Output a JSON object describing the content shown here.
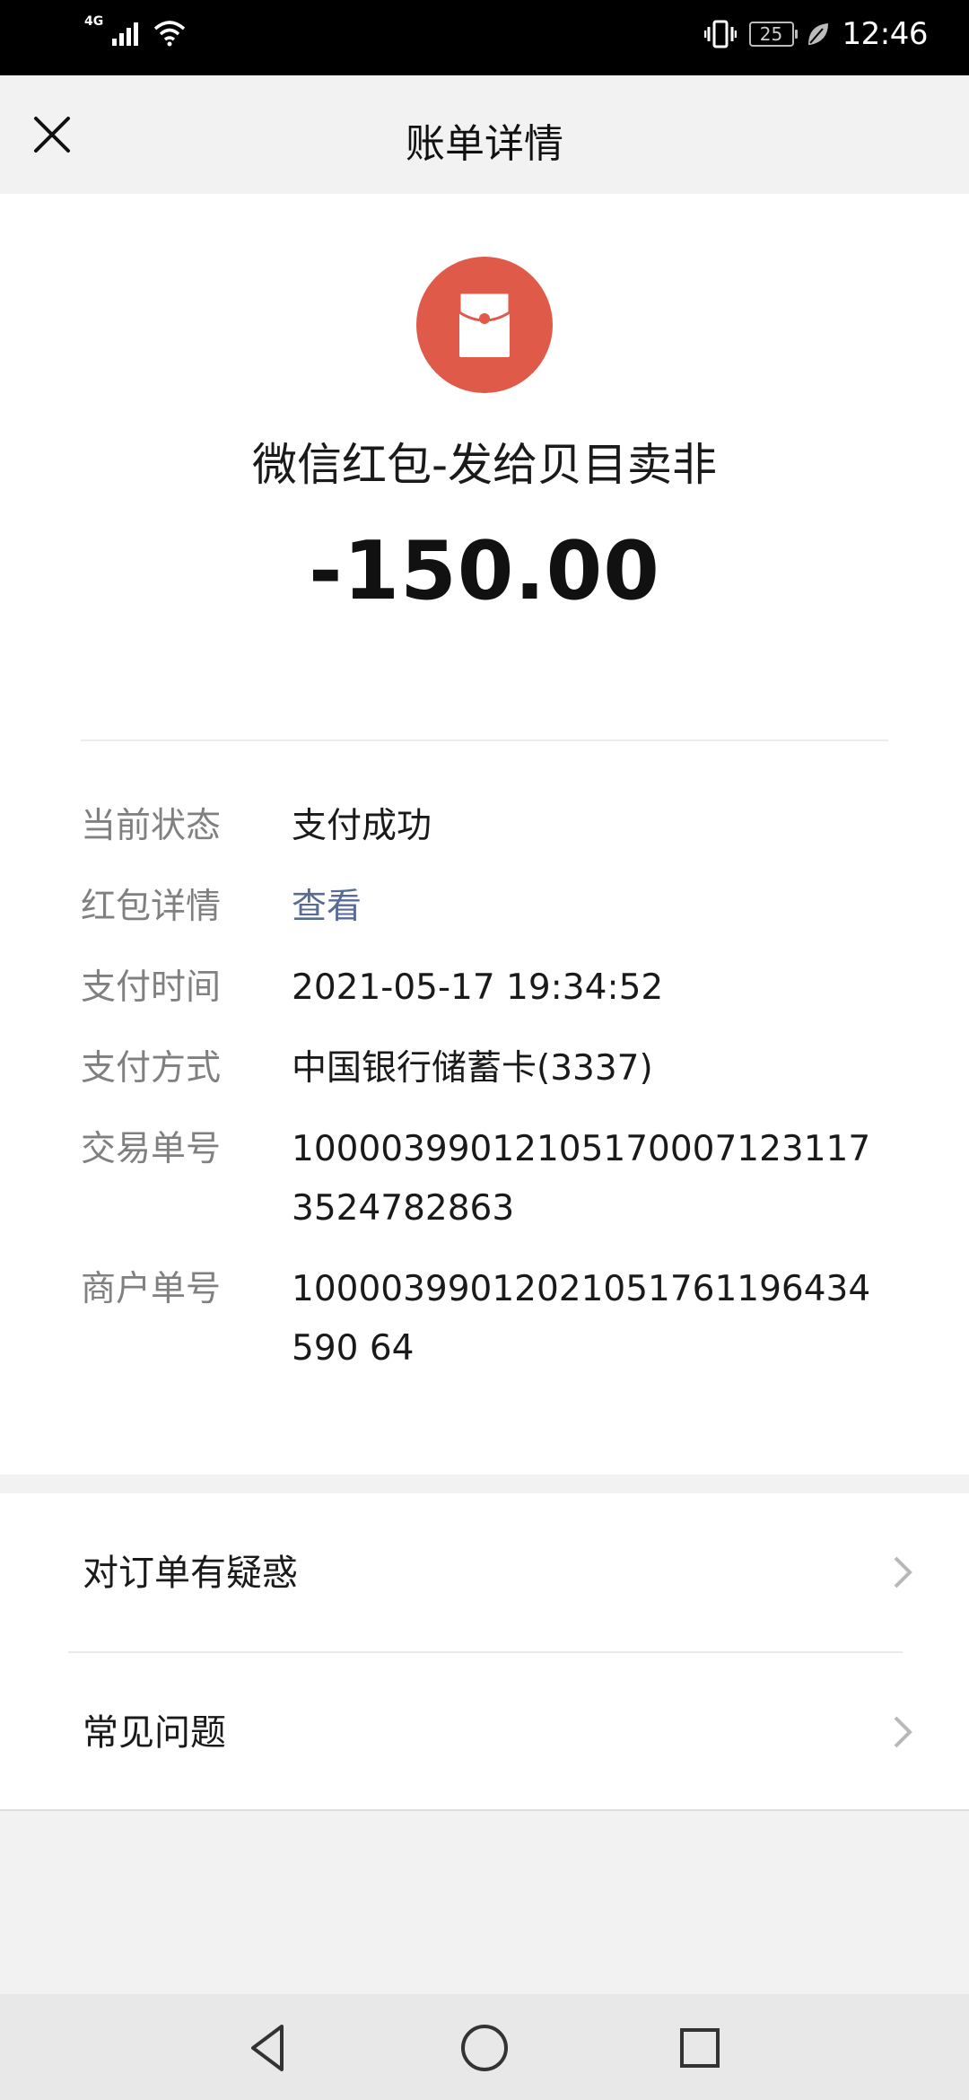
{
  "status_bar": {
    "network": "4G",
    "battery": "25",
    "time": "12:46",
    "icons": [
      "signal-icon",
      "wifi-icon",
      "vibrate-icon",
      "battery-icon",
      "leaf-icon"
    ]
  },
  "header": {
    "title": "账单详情",
    "close_icon": "close-icon"
  },
  "transaction": {
    "icon": "red-packet-icon",
    "title": "微信红包-发给贝目卖非",
    "amount": "-150.00"
  },
  "details": [
    {
      "label": "当前状态",
      "value": "支付成功"
    },
    {
      "label": "红包详情",
      "value": "查看"
    },
    {
      "label": "支付时间",
      "value": "2021-05-17 19:34:52"
    },
    {
      "label": "支付方式",
      "value": "中国银行储蓄卡(3337)"
    },
    {
      "label": "交易单号",
      "value": "100003990121051700071231173524782863"
    },
    {
      "label": "商户单号",
      "value": "10000399012021051761196434590 64"
    }
  ],
  "help": [
    {
      "label": "对订单有疑惑",
      "icon": "chevron-right-icon"
    },
    {
      "label": "常见问题",
      "icon": "chevron-right-icon"
    }
  ],
  "nav": {
    "icons": [
      "back-triangle-icon",
      "home-circle-icon",
      "recents-square-icon"
    ]
  },
  "colors": {
    "red_packet": "#e05a4a",
    "link": "#576b95"
  }
}
